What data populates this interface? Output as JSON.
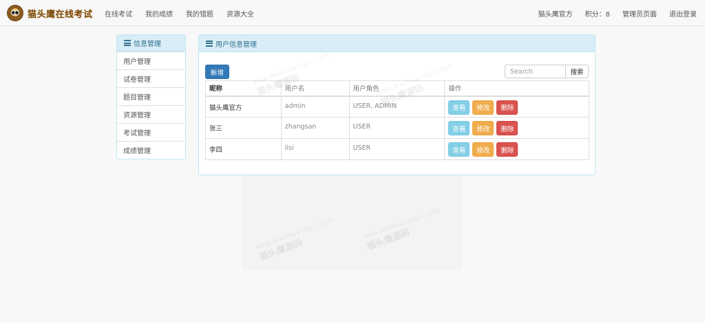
{
  "brand": {
    "name": "猫头鹰在线考试"
  },
  "nav": {
    "left": [
      "在线考试",
      "我的成绩",
      "我的错题",
      "资源大全"
    ],
    "user": "猫头鹰官方",
    "score": "积分：8",
    "admin": "管理员页面",
    "logout": "退出登录"
  },
  "sidebar": {
    "title": "信息管理",
    "items": [
      "用户管理",
      "试卷管理",
      "题目管理",
      "资源管理",
      "考试管理",
      "成绩管理"
    ]
  },
  "main": {
    "title": "用户信息管理",
    "new_label": "新增",
    "search_placeholder": "Search",
    "search_label": "搜索",
    "columns": [
      "昵称",
      "用户名",
      "用户角色",
      "操作"
    ],
    "rows": [
      {
        "nickname": "猫头鹰官方",
        "username": "admin",
        "roles": "USER, ADMIN"
      },
      {
        "nickname": "张三",
        "username": "zhangsan",
        "roles": "USER"
      },
      {
        "nickname": "李四",
        "username": "lisi",
        "roles": "USER"
      }
    ],
    "actions": {
      "view": "查看",
      "edit": "修改",
      "delete": "删除"
    }
  },
  "watermark": {
    "url": "www.maotouyingcc.com",
    "text": "猫头鹰源码"
  }
}
